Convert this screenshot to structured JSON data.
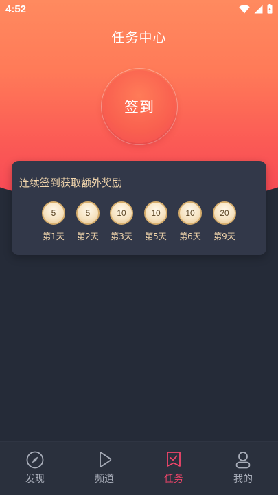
{
  "status_bar": {
    "time": "4:52",
    "icons": [
      "wifi-icon",
      "signal-icon",
      "battery-icon"
    ]
  },
  "header": {
    "title": "任务中心"
  },
  "checkin": {
    "button_label": "签到"
  },
  "reward_card": {
    "title": "连续签到获取额外奖励",
    "days": [
      {
        "value": "5",
        "label": "第1天"
      },
      {
        "value": "5",
        "label": "第2天"
      },
      {
        "value": "10",
        "label": "第3天"
      },
      {
        "value": "10",
        "label": "第5天"
      },
      {
        "value": "10",
        "label": "第6天"
      },
      {
        "value": "20",
        "label": "第9天"
      }
    ]
  },
  "bottom_nav": {
    "items": [
      {
        "label": "发现",
        "icon": "compass-icon",
        "active": false
      },
      {
        "label": "频道",
        "icon": "play-icon",
        "active": false
      },
      {
        "label": "任务",
        "icon": "task-check-icon",
        "active": true
      },
      {
        "label": "我的",
        "icon": "profile-icon",
        "active": false
      }
    ]
  },
  "colors": {
    "gradient_top": "#ff8a5f",
    "gradient_bottom": "#f64656",
    "background": "#252b38",
    "card": "#323849",
    "gold_text": "#f2d6ad",
    "active_tab": "#f2456a",
    "inactive_tab": "#a9aeba"
  }
}
